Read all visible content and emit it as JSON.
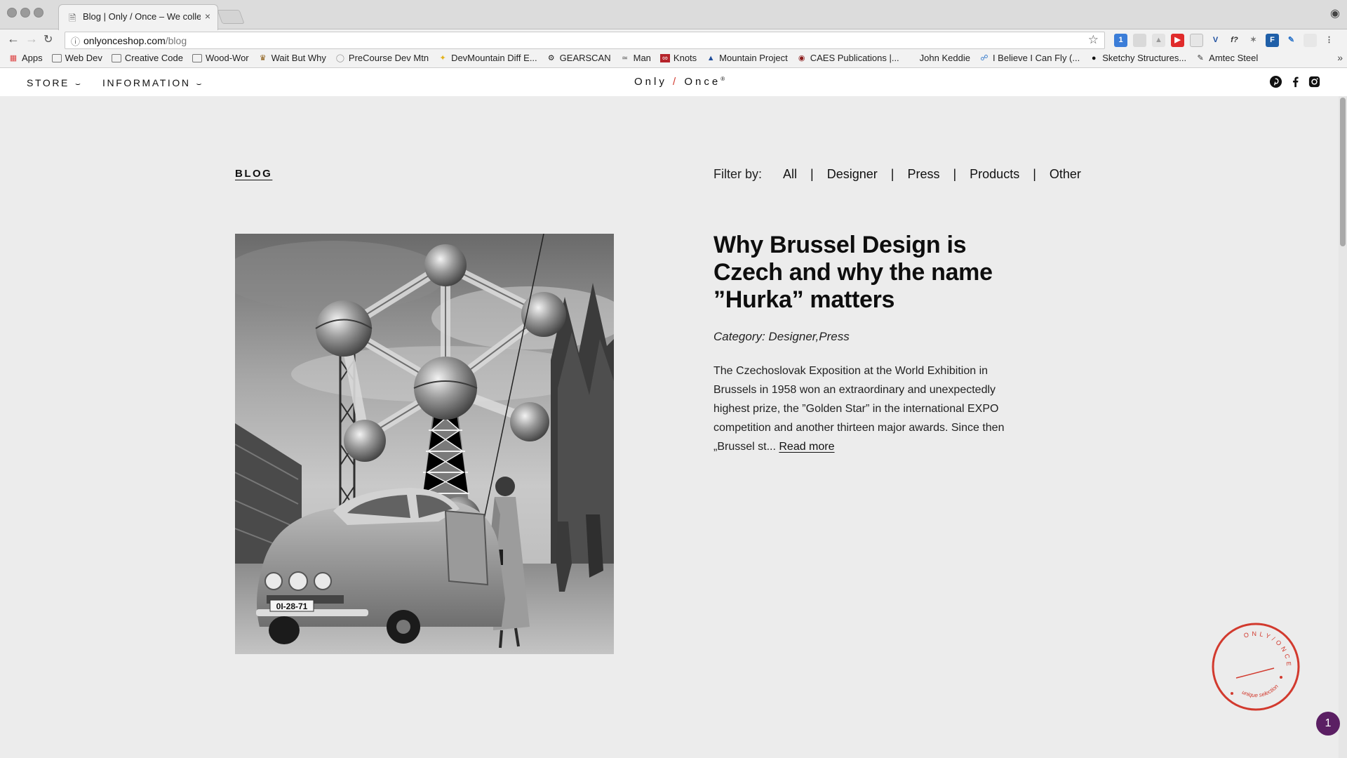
{
  "browser": {
    "tab_title": "Blog | Only / Once – We collect",
    "tab_close": "×",
    "url_host": "onlyonceshop.com",
    "url_path": "/blog",
    "bookmarks": [
      {
        "label": "Apps",
        "icon": "apps-grid-icon"
      },
      {
        "label": "Web Dev",
        "icon": "folder-icon"
      },
      {
        "label": "Creative Code",
        "icon": "folder-icon"
      },
      {
        "label": "Wood-Wor",
        "icon": "folder-icon"
      },
      {
        "label": "Wait But Why",
        "icon": "site-icon"
      },
      {
        "label": "PreCourse Dev Mtn",
        "icon": "site-icon"
      },
      {
        "label": "DevMountain Diff E...",
        "icon": "site-icon"
      },
      {
        "label": "GEARSCAN",
        "icon": "site-icon"
      },
      {
        "label": "Man",
        "icon": "site-icon"
      },
      {
        "label": "Knots",
        "icon": "site-icon"
      },
      {
        "label": "Mountain Project",
        "icon": "site-icon"
      },
      {
        "label": "CAES Publications |...",
        "icon": "site-icon"
      },
      {
        "label": "John Keddie",
        "icon": "site-icon"
      },
      {
        "label": "I Believe I Can Fly (...",
        "icon": "site-icon"
      },
      {
        "label": "Sketchy Structures...",
        "icon": "site-icon"
      },
      {
        "label": "Amtec Steel",
        "icon": "site-icon"
      }
    ],
    "bookmarks_more": "»"
  },
  "header": {
    "store_label": "STORE",
    "information_label": "INFORMATION",
    "logo_left": "Only",
    "logo_slash": "/",
    "logo_right": "Once",
    "logo_mark": "®"
  },
  "blog": {
    "heading": "BLOG",
    "filter_label": "Filter by:",
    "filters": [
      "All",
      "Designer",
      "Press",
      "Products",
      "Other"
    ],
    "separator": "|"
  },
  "post": {
    "title": "Why Brussel Design is Czech and why the name ”Hurka” matters",
    "category": "Category: Designer,Press",
    "excerpt": "The Czechoslovak Exposition at the World Exhibition in Brussels in 1958 won an extraordinary and unexpectedly highest prize, the ”Golden Star” in the international EXPO competition and another thirteen major awards. Since then „Brussel st...",
    "read_more": "Read more",
    "image_plate": "0I-28-71"
  },
  "stamp": {
    "top_text": "ONLY/ONCE",
    "bottom_text": "unique selection",
    "color": "#d23a2e"
  },
  "chat": {
    "count": "1",
    "color": "#5b1f63"
  }
}
